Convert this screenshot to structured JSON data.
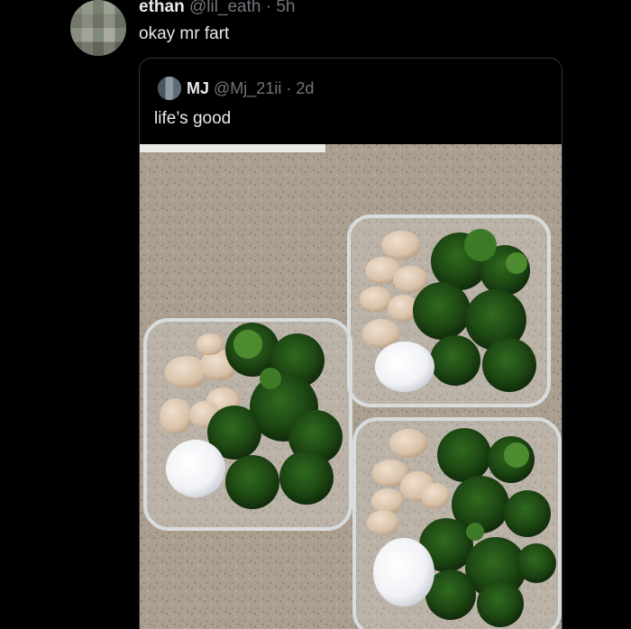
{
  "tweet": {
    "author_name": "ethan",
    "handle": "@lil_eath",
    "separator": " · ",
    "timestamp": "5h",
    "text": "okay mr fart"
  },
  "quote": {
    "author_name": "MJ",
    "handle": "@Mj_21ii",
    "separator": " · ",
    "timestamp": "2d",
    "text": "life’s good"
  },
  "colors": {
    "background": "#000000",
    "text_primary": "#e7e9ea",
    "text_muted": "#71767b",
    "border": "#2f3336"
  }
}
